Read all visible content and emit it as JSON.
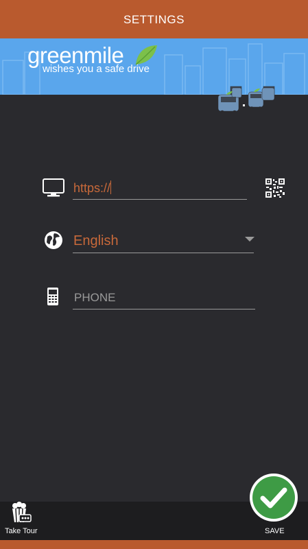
{
  "header": {
    "title": "SETTINGS"
  },
  "banner": {
    "brand": "greenmile",
    "tagline": "wishes you a safe drive"
  },
  "form": {
    "url": {
      "value": "https://",
      "icon": "monitor-icon",
      "qr_icon": "qr-code-icon"
    },
    "language": {
      "value": "English",
      "icon": "globe-icon"
    },
    "phone": {
      "placeholder": "PHONE",
      "value": "",
      "icon": "mobile-phone-icon"
    }
  },
  "footer": {
    "tour_label": "Take Tour",
    "save_label": "SAVE"
  },
  "colors": {
    "accent": "#b95a2e",
    "banner": "#5aa6ec",
    "background": "#2a2a2e",
    "save_green": "#3e9b45",
    "input_text": "#c8693a"
  }
}
